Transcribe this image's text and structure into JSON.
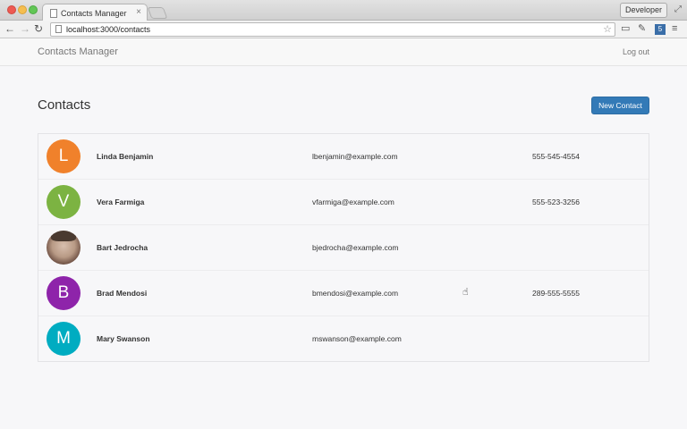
{
  "browser": {
    "tab_title": "Contacts Manager",
    "tab_close": "×",
    "profile_button": "Developer",
    "url": "localhost:3000/contacts",
    "icons": {
      "back": "back-arrow-icon",
      "forward": "forward-arrow-icon",
      "reload": "reload-icon",
      "star": "bookmark-star-icon",
      "menu": "hamburger-menu-icon"
    }
  },
  "navbar": {
    "brand": "Contacts Manager",
    "logout": "Log out"
  },
  "page": {
    "title": "Contacts",
    "new_contact_label": "New Contact"
  },
  "colors": {
    "primary_button": "#337ab7"
  },
  "contacts": [
    {
      "initial": "L",
      "avatar_color": "#f0812b",
      "name": "Linda Benjamin",
      "email": "lbenjamin@example.com",
      "phone": "555-545-4554"
    },
    {
      "initial": "V",
      "avatar_color": "#7cb342",
      "name": "Vera Farmiga",
      "email": "vfarmiga@example.com",
      "phone": "555-523-3256"
    },
    {
      "initial": "",
      "avatar_color": "photo",
      "name": "Bart Jedrocha",
      "email": "bjedrocha@example.com",
      "phone": ""
    },
    {
      "initial": "B",
      "avatar_color": "#8e24aa",
      "name": "Brad Mendosi",
      "email": "bmendosi@example.com",
      "phone": "289-555-5555"
    },
    {
      "initial": "M",
      "avatar_color": "#00acc1",
      "name": "Mary Swanson",
      "email": "mswanson@example.com",
      "phone": ""
    }
  ]
}
